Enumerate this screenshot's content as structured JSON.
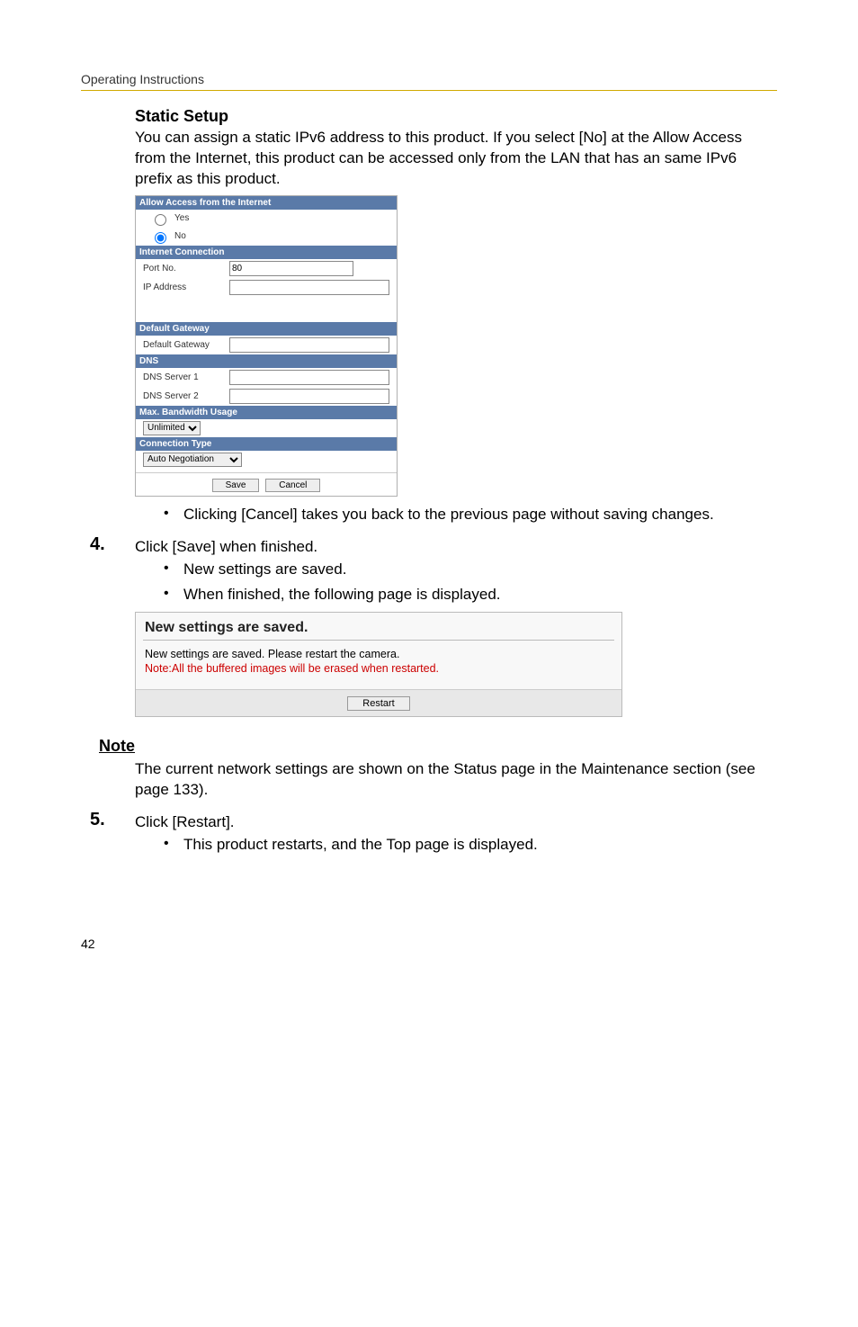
{
  "header": "Operating Instructions",
  "static_heading": "Static Setup",
  "para_static": "You can assign a static IPv6 address to this product. If you select [No] at the Allow Access from the Internet, this product can be accessed only from the LAN that has an same IPv6 prefix as this product.",
  "form": {
    "allow_access_title": "Allow Access from the Internet",
    "yes": "Yes",
    "no": "No",
    "internet_connection_title": "Internet Connection",
    "port_no_label": "Port No.",
    "port_no_value": "80",
    "ip_address_label": "IP Address",
    "default_gateway_title": "Default Gateway",
    "default_gateway_label": "Default Gateway",
    "dns_title": "DNS",
    "dns1_label": "DNS Server 1",
    "dns2_label": "DNS Server 2",
    "max_bw_title": "Max. Bandwidth Usage",
    "max_bw_value": "Unlimited",
    "conn_type_title": "Connection Type",
    "conn_type_value": "Auto Negotiation",
    "save": "Save",
    "cancel": "Cancel"
  },
  "bullet_cancel": "Clicking [Cancel] takes you back to the previous page without saving changes.",
  "step4_num": "4.",
  "step4_text": "Click [Save] when finished.",
  "step4_b1": "New settings are saved.",
  "step4_b2": "When finished, the following page is displayed.",
  "dialog": {
    "title": "New settings are saved.",
    "line1": "New settings are saved. Please restart the camera.",
    "line2": "Note:All the buffered images will be erased when restarted.",
    "restart": "Restart"
  },
  "note_heading": "Note",
  "note_text": "The current network settings are shown on the Status page in the Maintenance section (see page 133).",
  "step5_num": "5.",
  "step5_text": "Click [Restart].",
  "step5_b1": "This product restarts, and the Top page is displayed.",
  "page_number": "42"
}
